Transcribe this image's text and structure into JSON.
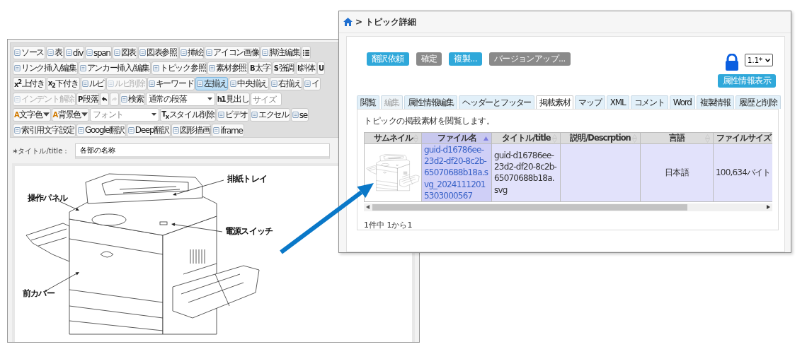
{
  "editor": {
    "toolbar_rows": [
      [
        {
          "kind": "button",
          "label": "ソース",
          "disabled": false,
          "selected": false
        },
        {
          "kind": "button",
          "label": "表",
          "disabled": false,
          "selected": false
        },
        {
          "kind": "button",
          "label": "div",
          "disabled": false,
          "selected": false
        },
        {
          "kind": "button",
          "label": "span",
          "disabled": false,
          "selected": false
        },
        {
          "kind": "button",
          "label": "図表",
          "disabled": false,
          "selected": false
        },
        {
          "kind": "button",
          "label": "図表参照",
          "disabled": false,
          "selected": false
        },
        {
          "kind": "button",
          "label": "挿絵",
          "disabled": false,
          "selected": false
        },
        {
          "kind": "button",
          "label": "アイコン画像",
          "disabled": false,
          "selected": false
        },
        {
          "kind": "button",
          "label": "脚注編集",
          "disabled": false,
          "selected": false
        },
        {
          "kind": "list",
          "disabled": false,
          "selected": false
        }
      ],
      [
        {
          "kind": "button",
          "label": "リンク挿入/編集",
          "disabled": false,
          "selected": false
        },
        {
          "kind": "button",
          "label": "アンカー挿入/編集",
          "disabled": false,
          "selected": false
        },
        {
          "kind": "button",
          "label": "トピック参照",
          "disabled": false,
          "selected": false
        },
        {
          "kind": "button",
          "label": "素材参照",
          "disabled": false,
          "selected": false
        },
        {
          "kind": "button",
          "glyph": "B",
          "label": "太字",
          "disabled": false,
          "selected": false
        },
        {
          "kind": "button",
          "glyph": "S",
          "label": "強調",
          "disabled": false,
          "selected": false
        },
        {
          "kind": "button",
          "glyph": "I",
          "label": "斜体",
          "disabled": false,
          "selected": false
        },
        {
          "kind": "button",
          "glyph": "U",
          "disabled": false,
          "selected": false
        }
      ],
      [
        {
          "kind": "button",
          "glyph": "x$^{2}$",
          "label": "上付き",
          "disabled": false,
          "selected": false
        },
        {
          "kind": "button",
          "glyph": "x$_{2}$",
          "label": "下付き",
          "disabled": false,
          "selected": false
        },
        {
          "kind": "button",
          "label": "ルビ",
          "disabled": false,
          "selected": false
        },
        {
          "kind": "button",
          "label": "ルビ削除",
          "disabled": true,
          "selected": false
        },
        {
          "kind": "button",
          "label": "キーワード",
          "disabled": false,
          "selected": false
        },
        {
          "kind": "button",
          "label": "左揃え",
          "disabled": false,
          "selected": true
        },
        {
          "kind": "button",
          "label": "中央揃え",
          "disabled": false,
          "selected": false
        },
        {
          "kind": "button",
          "label": "右揃え",
          "disabled": false,
          "selected": false
        },
        {
          "kind": "button",
          "label": "イ",
          "disabled": false,
          "selected": false
        }
      ],
      [
        {
          "kind": "button",
          "label": "インデント解除",
          "disabled": true,
          "selected": false
        },
        {
          "kind": "button",
          "glyph": "P",
          "label": "段落",
          "disabled": false,
          "selected": false
        },
        {
          "kind": "undo",
          "disabled": false,
          "selected": false
        },
        {
          "kind": "redo",
          "disabled": true,
          "selected": false
        },
        {
          "kind": "button",
          "label": "検索",
          "disabled": false,
          "selected": false
        },
        {
          "kind": "select",
          "value": "通常の段落",
          "disabled": false,
          "selected": false
        },
        {
          "kind": "button",
          "glyph": "h1",
          "label": "見出し",
          "disabled": false,
          "selected": false
        },
        {
          "kind": "field",
          "placeholder": "サイズ",
          "disabled": false,
          "selected": false
        }
      ],
      [
        {
          "kind": "menu",
          "glyph": "A",
          "label": "文字色",
          "disabled": false,
          "selected": false
        },
        {
          "kind": "menu",
          "glyph": "A",
          "label": "背景色",
          "disabled": false,
          "selected": false
        },
        {
          "kind": "select",
          "placeholder": "フォント",
          "disabled": false,
          "selected": false
        },
        {
          "kind": "button",
          "glyph": "T$_{x}$",
          "label": "スタイル削除",
          "disabled": false,
          "selected": false
        },
        {
          "kind": "button",
          "label": "ビデオ",
          "disabled": false,
          "selected": false
        },
        {
          "kind": "button",
          "label": "エクセル",
          "disabled": false,
          "selected": false
        },
        {
          "kind": "button",
          "label": "se",
          "disabled": false,
          "selected": false
        }
      ],
      [
        {
          "kind": "button",
          "label": "索引用文字設定",
          "disabled": false,
          "selected": false
        },
        {
          "kind": "button",
          "label": "Google翻訳",
          "disabled": false,
          "selected": false
        },
        {
          "kind": "button",
          "label": "Deep翻訳",
          "disabled": false,
          "selected": false
        },
        {
          "kind": "button",
          "label": "図形描画",
          "disabled": false,
          "selected": false
        },
        {
          "kind": "button",
          "label": "iframe",
          "disabled": false,
          "selected": false
        }
      ]
    ],
    "title_field": {
      "label": "∗タイトル/title：",
      "value": "各部の名称"
    },
    "figure": {
      "callouts": [
        {
          "text": "排紙トレイ"
        },
        {
          "text": "操作パネル"
        },
        {
          "text": "電源スイッチ"
        },
        {
          "text": "前カバー"
        }
      ]
    }
  },
  "detail": {
    "breadcrumb": {
      "separator": ">",
      "current": "トピック詳細"
    },
    "actions": [
      {
        "label": "翻訳依頼",
        "disabled": false
      },
      {
        "label": "確定",
        "disabled": true
      },
      {
        "label": "複製...",
        "disabled": false
      },
      {
        "label": "バージョンアップ...",
        "disabled": true
      }
    ],
    "locked": true,
    "version_select": {
      "value": "1.1*"
    },
    "attribute_button": "属性情報表示",
    "tabs": [
      {
        "label": "閲覧",
        "selected": false,
        "disabled": false
      },
      {
        "label": "編集",
        "selected": false,
        "disabled": true
      },
      {
        "label": "属性情報編集",
        "selected": false,
        "disabled": false
      },
      {
        "label": "ヘッダーとフッター",
        "selected": false,
        "disabled": false
      },
      {
        "label": "掲載素材",
        "selected": true,
        "disabled": false
      },
      {
        "label": "マップ",
        "selected": false,
        "disabled": false
      },
      {
        "label": "XML",
        "selected": false,
        "disabled": false
      },
      {
        "label": "コメント",
        "selected": false,
        "disabled": false
      },
      {
        "label": "Word",
        "selected": false,
        "disabled": false
      },
      {
        "label": "複製情報",
        "selected": false,
        "disabled": false
      },
      {
        "label": "履歴と削除",
        "selected": false,
        "disabled": false
      }
    ],
    "description": "トピックの掲載素材を閲覧します。",
    "table": {
      "columns": [
        {
          "label": "サムネイル",
          "sorted": false
        },
        {
          "label": "ファイル名",
          "sorted": true
        },
        {
          "label": "タイトル/title",
          "sorted": false
        },
        {
          "label": "説明/Descrption",
          "sorted": false
        },
        {
          "label": "言語",
          "sorted": false
        },
        {
          "label": "ファイルサイズ",
          "sorted": false
        }
      ],
      "rows": [
        {
          "file_name": "guid-d16786ee-23d2-df20-8c2b-65070688b18a.svg_20241112015303000567",
          "title": "guid-d16786ee-23d2-df20-8c2b-65070688b18a.svg",
          "language": "日本語",
          "file_size": "100,634バイト"
        }
      ]
    },
    "pagination_info": "1件中 1から1"
  }
}
